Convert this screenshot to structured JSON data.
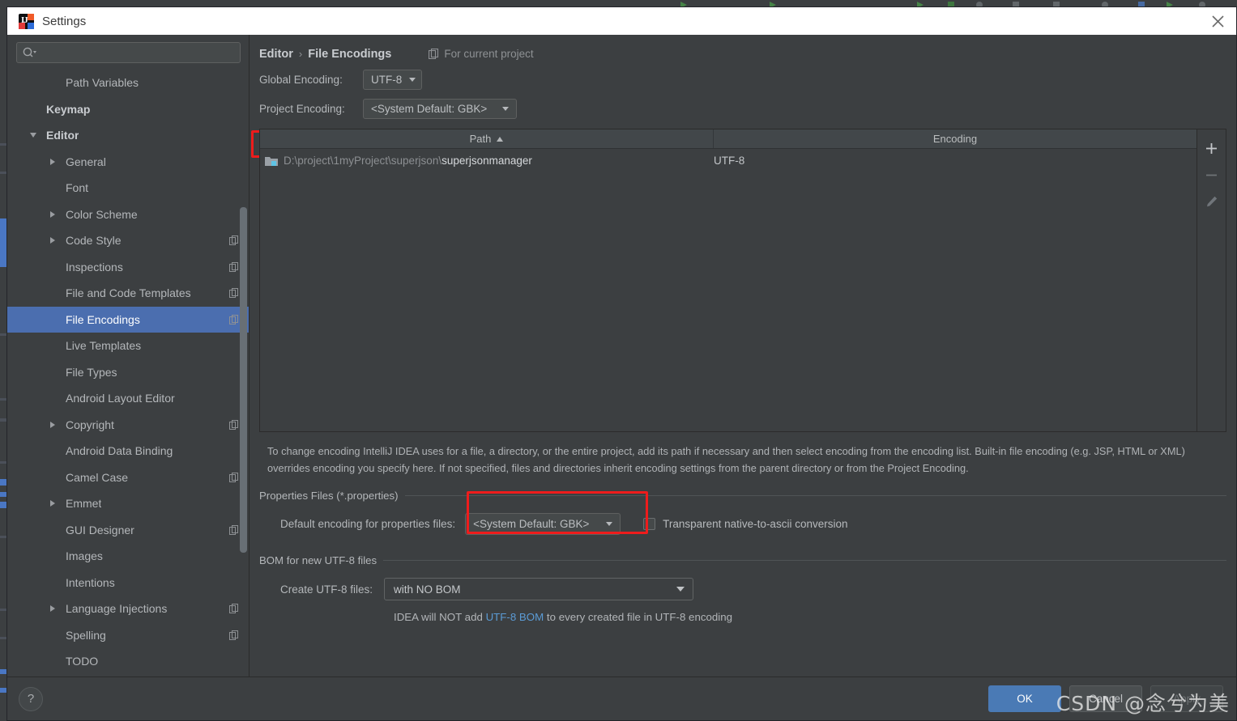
{
  "window": {
    "title": "Settings",
    "app_icon": "intellij-idea-icon",
    "close_icon": "close-icon"
  },
  "sidebar": {
    "search": {
      "placeholder": "",
      "value": "",
      "icon": "search-icon"
    },
    "items": [
      {
        "label": "Path Variables",
        "indent": 1,
        "arrow": "none",
        "bold": false,
        "copy": false,
        "selected": false
      },
      {
        "label": "Keymap",
        "indent": 0,
        "arrow": "none",
        "bold": true,
        "copy": false,
        "selected": false
      },
      {
        "label": "Editor",
        "indent": 0,
        "arrow": "down",
        "bold": true,
        "copy": false,
        "selected": false
      },
      {
        "label": "General",
        "indent": 1,
        "arrow": "right",
        "bold": false,
        "copy": false,
        "selected": false
      },
      {
        "label": "Font",
        "indent": 1,
        "arrow": "none",
        "bold": false,
        "copy": false,
        "selected": false
      },
      {
        "label": "Color Scheme",
        "indent": 1,
        "arrow": "right",
        "bold": false,
        "copy": false,
        "selected": false
      },
      {
        "label": "Code Style",
        "indent": 1,
        "arrow": "right",
        "bold": false,
        "copy": true,
        "selected": false
      },
      {
        "label": "Inspections",
        "indent": 1,
        "arrow": "none",
        "bold": false,
        "copy": true,
        "selected": false
      },
      {
        "label": "File and Code Templates",
        "indent": 1,
        "arrow": "none",
        "bold": false,
        "copy": true,
        "selected": false
      },
      {
        "label": "File Encodings",
        "indent": 1,
        "arrow": "none",
        "bold": false,
        "copy": true,
        "selected": true
      },
      {
        "label": "Live Templates",
        "indent": 1,
        "arrow": "none",
        "bold": false,
        "copy": false,
        "selected": false
      },
      {
        "label": "File Types",
        "indent": 1,
        "arrow": "none",
        "bold": false,
        "copy": false,
        "selected": false
      },
      {
        "label": "Android Layout Editor",
        "indent": 1,
        "arrow": "none",
        "bold": false,
        "copy": false,
        "selected": false
      },
      {
        "label": "Copyright",
        "indent": 1,
        "arrow": "right",
        "bold": false,
        "copy": true,
        "selected": false
      },
      {
        "label": "Android Data Binding",
        "indent": 1,
        "arrow": "none",
        "bold": false,
        "copy": false,
        "selected": false
      },
      {
        "label": "Camel Case",
        "indent": 1,
        "arrow": "none",
        "bold": false,
        "copy": true,
        "selected": false
      },
      {
        "label": "Emmet",
        "indent": 1,
        "arrow": "right",
        "bold": false,
        "copy": false,
        "selected": false
      },
      {
        "label": "GUI Designer",
        "indent": 1,
        "arrow": "none",
        "bold": false,
        "copy": true,
        "selected": false
      },
      {
        "label": "Images",
        "indent": 1,
        "arrow": "none",
        "bold": false,
        "copy": false,
        "selected": false
      },
      {
        "label": "Intentions",
        "indent": 1,
        "arrow": "none",
        "bold": false,
        "copy": false,
        "selected": false
      },
      {
        "label": "Language Injections",
        "indent": 1,
        "arrow": "right",
        "bold": false,
        "copy": true,
        "selected": false
      },
      {
        "label": "Spelling",
        "indent": 1,
        "arrow": "none",
        "bold": false,
        "copy": true,
        "selected": false
      },
      {
        "label": "TODO",
        "indent": 1,
        "arrow": "none",
        "bold": false,
        "copy": false,
        "selected": false
      }
    ]
  },
  "content": {
    "breadcrumb": {
      "parent": "Editor",
      "separator": "›",
      "current": "File Encodings"
    },
    "for_current_project": {
      "label": "For current project",
      "icon": "copy-project-icon"
    },
    "global_encoding": {
      "label": "Global Encoding:",
      "value": "UTF-8"
    },
    "project_encoding": {
      "label": "Project Encoding:",
      "value": "<System Default: GBK>",
      "highlighted": true
    },
    "table": {
      "columns": [
        "Path",
        "Encoding"
      ],
      "sort_column": "Path",
      "sort_direction": "asc",
      "rows": [
        {
          "path_dim": "D:\\project\\1myProject\\superjson\\",
          "path_strong": "superjsonmanager",
          "encoding": "UTF-8",
          "icon": "folder-icon"
        }
      ],
      "toolbar": [
        {
          "name": "add-button",
          "glyph": "+",
          "enabled": true
        },
        {
          "name": "remove-button",
          "glyph": "−",
          "enabled": false
        },
        {
          "name": "edit-button",
          "glyph": "pencil",
          "enabled": false
        }
      ]
    },
    "hint": "To change encoding IntelliJ IDEA uses for a file, a directory, or the entire project, add its path if necessary and then select encoding from the encoding list. Built-in file encoding (e.g. JSP, HTML or XML) overrides encoding you specify here. If not specified, files and directories inherit encoding settings from the parent directory or from the Project Encoding.",
    "properties_section": {
      "title": "Properties Files (*.properties)",
      "default_encoding_label": "Default encoding for properties files:",
      "default_encoding_value": "<System Default: GBK>",
      "highlighted": true,
      "transparent_checkbox_label": "Transparent native-to-ascii conversion",
      "transparent_checkbox_checked": false
    },
    "bom_section": {
      "title": "BOM for new UTF-8 files",
      "create_label": "Create UTF-8 files:",
      "create_value": "with NO BOM",
      "note_prefix": "IDEA will NOT add ",
      "note_link": "UTF-8 BOM",
      "note_suffix": " to every created file in UTF-8 encoding"
    }
  },
  "footer": {
    "help_label": "?",
    "ok_label": "OK",
    "cancel_label": "Cancel",
    "apply_label": "Apply",
    "apply_enabled": false
  },
  "watermark": "CSDN @念兮为美",
  "colors": {
    "dialog_bg": "#3c3f41",
    "selection_blue": "#4b6eaf",
    "accent_red": "#ee1c1c",
    "primary_button": "#4a7ab5",
    "link_blue": "#5b9bd5"
  }
}
